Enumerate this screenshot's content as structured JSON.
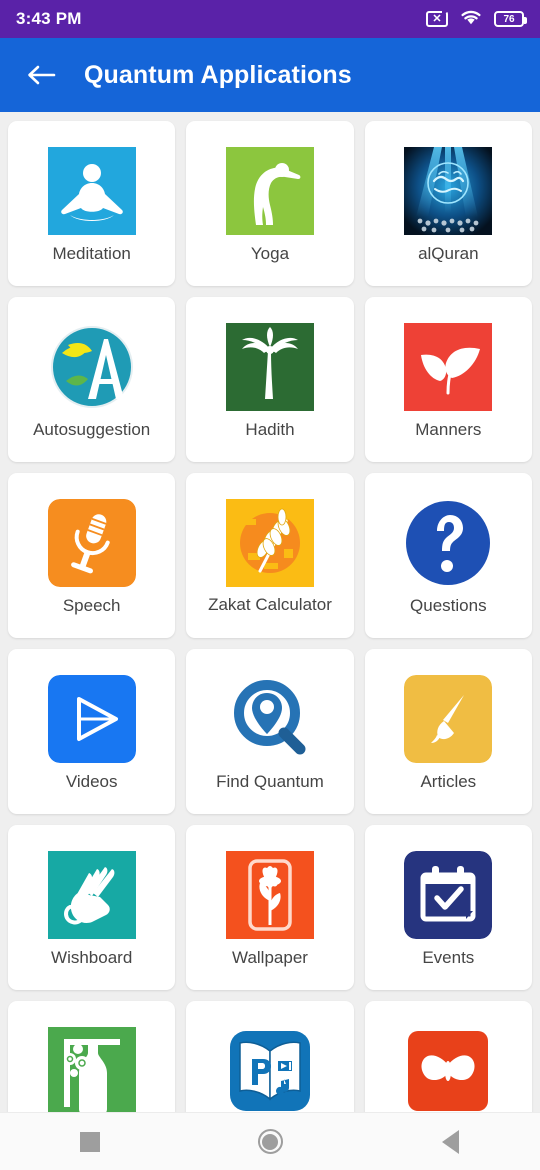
{
  "statusbar": {
    "time": "3:43 PM",
    "sim_icon": "no-sim-icon",
    "sim_glyph": "✕",
    "wifi_icon": "wifi-icon",
    "battery_icon": "battery-icon",
    "battery_level": "76",
    "bg_color": "#5a22a8"
  },
  "appbar": {
    "back_icon": "back-arrow-icon",
    "title": "Quantum Applications",
    "bg_color": "#1565d8"
  },
  "grid": {
    "tiles": [
      {
        "label": "Meditation",
        "icon": "meditation-icon",
        "color": "#22a7dd"
      },
      {
        "label": "Yoga",
        "icon": "yoga-icon",
        "color": "#8cc63e"
      },
      {
        "label": "alQuran",
        "icon": "alquran-icon",
        "color": "#0b1b33"
      },
      {
        "label": "Autosuggestion",
        "icon": "autosuggestion-icon",
        "color": "#1f9bb5"
      },
      {
        "label": "Hadith",
        "icon": "hadith-icon",
        "color": "#2c6b33"
      },
      {
        "label": "Manners",
        "icon": "manners-icon",
        "color": "#ee4136"
      },
      {
        "label": "Speech",
        "icon": "speech-icon",
        "color": "#f68d1f"
      },
      {
        "label": "Zakat Calculator",
        "icon": "zakat-calculator-icon",
        "color": "#fbbc14"
      },
      {
        "label": "Questions",
        "icon": "questions-icon",
        "color": "#1e50b4"
      },
      {
        "label": "Videos",
        "icon": "videos-icon",
        "color": "#1877f2"
      },
      {
        "label": "Find Quantum",
        "icon": "find-quantum-icon",
        "color": "#2673b5"
      },
      {
        "label": "Articles",
        "icon": "articles-icon",
        "color": "#f0bd43"
      },
      {
        "label": "Wishboard",
        "icon": "wishboard-icon",
        "color": "#17a9a4"
      },
      {
        "label": "Wallpaper",
        "icon": "wallpaper-icon",
        "color": "#f4511e"
      },
      {
        "label": "Events",
        "icon": "events-icon",
        "color": "#26347f"
      },
      {
        "label": "",
        "icon": "bottle-icon",
        "color": "#4ba94d"
      },
      {
        "label": "",
        "icon": "parenting-book-icon",
        "color": "#1174b8"
      },
      {
        "label": "",
        "icon": "butterfly-icon",
        "color": "#e8411a"
      }
    ]
  },
  "navbar": {
    "recents_icon": "recents-square-icon",
    "home_icon": "home-circle-icon",
    "back_icon": "back-triangle-icon"
  }
}
